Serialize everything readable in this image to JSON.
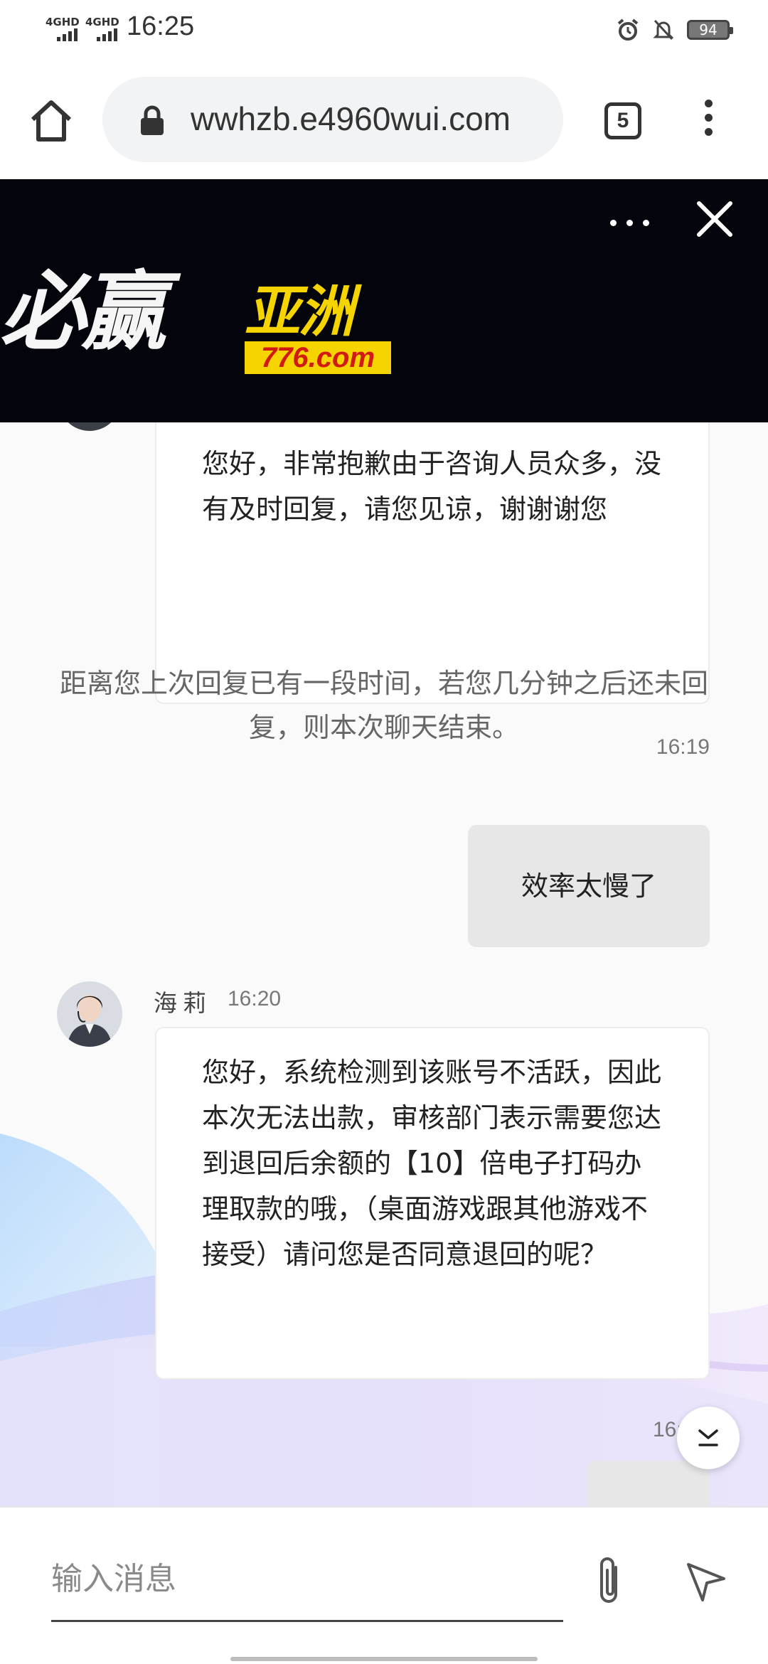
{
  "status_bar": {
    "signal1": "4GHD",
    "signal2": "4GHD",
    "time": "16:25",
    "icons": [
      "alarm-icon",
      "mute-icon"
    ],
    "battery": "94"
  },
  "browser": {
    "home_icon": "home-icon",
    "lock_icon": "lock-icon",
    "url": "wwhzb.e4960wui.com",
    "tab_count": "5",
    "menu_icon": "more-vert-icon"
  },
  "ad": {
    "brand": "必赢",
    "sub": "亚洲",
    "domain": "776.com",
    "more_icon": "more-horiz-icon",
    "close_icon": "close-icon"
  },
  "chat": {
    "messages": [
      {
        "sender": "agent",
        "text": "您好，非常抱歉由于咨询人员众多，没有及时回复，请您见谅，谢谢谢您"
      },
      {
        "sender": "system",
        "text": "距离您上次回复已有一段时间，若您几分钟之后还未回复，则本次聊天结束。"
      },
      {
        "sender": "user",
        "time": "16:19",
        "text": "效率太慢了"
      },
      {
        "sender": "agent",
        "name": "海莉",
        "time": "16:20",
        "text": "您好，系统检测到该账号不活跃，因此本次无法出款，审核部门表示需要您达到退回后余额的【10】倍电子打码办理取款的哦，（桌面游戏跟其他游戏不接受）请问您是否同意退回的呢？"
      }
    ],
    "partial_time": "16:",
    "scroll_icon": "scroll-down-icon"
  },
  "input": {
    "placeholder": "输入消息",
    "value": "",
    "attach_icon": "paperclip-icon",
    "send_icon": "send-icon"
  },
  "colors": {
    "ad_background": "#03040c",
    "ad_yellow": "#f5d400",
    "ad_red": "#d01a12",
    "user_bubble": "#e7e7e7"
  }
}
